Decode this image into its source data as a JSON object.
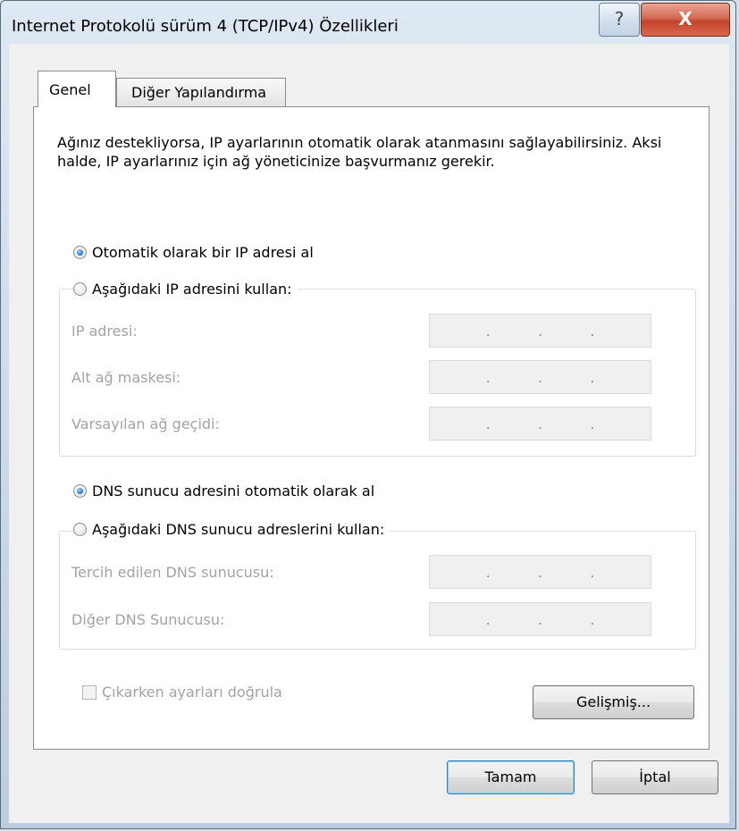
{
  "window": {
    "title": "Internet Protokolü sürüm 4 (TCP/IPv4) Özellikleri",
    "help_glyph": "?",
    "close_glyph": "X"
  },
  "tabs": [
    {
      "label": "Genel",
      "active": true
    },
    {
      "label": "Diğer Yapılandırma",
      "active": false
    }
  ],
  "description": "Ağınız destekliyorsa, IP ayarlarının otomatik olarak atanmasını sağlayabilirsiniz. Aksi halde, IP ayarlarınız için ağ yöneticinize başvurmanız gerekir.",
  "ip_section": {
    "auto_label": "Otomatik olarak bir IP adresi al",
    "auto_selected": true,
    "manual_label": "Aşağıdaki IP adresini kullan:",
    "fields": [
      {
        "label": "IP adresi:",
        "value": ". . ."
      },
      {
        "label": "Alt ağ maskesi:",
        "value": ". . ."
      },
      {
        "label": "Varsayılan ağ geçidi:",
        "value": ". . ."
      }
    ]
  },
  "dns_section": {
    "auto_label": "DNS sunucu adresini otomatik olarak al",
    "auto_selected": true,
    "manual_label": "Aşağıdaki DNS sunucu adreslerini kullan:",
    "fields": [
      {
        "label": "Tercih edilen DNS sunucusu:",
        "value": ". . ."
      },
      {
        "label": "Diğer DNS Sunucusu:",
        "value": ". . ."
      }
    ]
  },
  "validate_checkbox": {
    "label": "Çıkarken ayarları doğrula",
    "checked": false,
    "enabled": false
  },
  "buttons": {
    "advanced": "Gelişmiş...",
    "ok": "Tamam",
    "cancel": "İptal"
  }
}
